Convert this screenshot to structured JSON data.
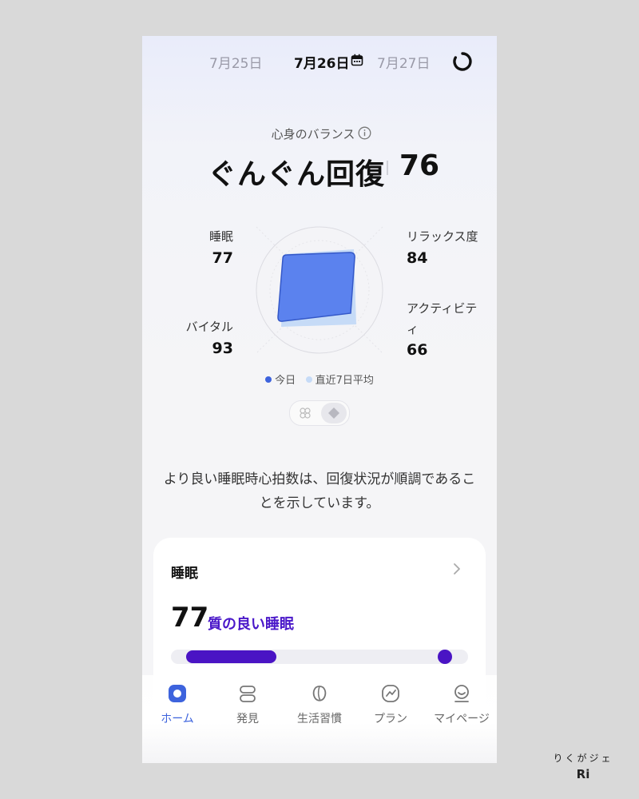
{
  "header": {
    "prev_date": "7月25日",
    "current_date": "7月26日",
    "next_date": "7月27日",
    "calendar_icon": "calendar-icon",
    "sync_icon": "sync-icon"
  },
  "balance": {
    "label": "心身のバランス",
    "state": "ぐんぐん回復",
    "score": "76",
    "metrics": {
      "sleep": {
        "label": "睡眠",
        "value": "77"
      },
      "relax": {
        "label": "リラックス度",
        "value": "84"
      },
      "activity": {
        "label": "アクティビティ",
        "value": "66"
      },
      "vital": {
        "label": "バイタル",
        "value": "93"
      }
    },
    "legend": {
      "today": "今日",
      "avg7": "直近7日平均",
      "today_color": "#3d63dd",
      "avg7_color": "#c6dbf7"
    }
  },
  "description": "より良い睡眠時心拍数は、回復状況が順調であることを示しています。",
  "sleep_card": {
    "title": "睡眠",
    "score": "77",
    "quality": "質の良い睡眠",
    "accent": "#4a14c4"
  },
  "tabs": [
    {
      "label": "ホーム",
      "icon": "home-icon",
      "active": true
    },
    {
      "label": "発見",
      "icon": "discover-icon"
    },
    {
      "label": "生活習慣",
      "icon": "habits-icon"
    },
    {
      "label": "プラン",
      "icon": "plan-icon"
    },
    {
      "label": "マイページ",
      "icon": "profile-icon"
    }
  ],
  "watermark": {
    "line1": "りくがジェ",
    "line2": "Ri"
  }
}
